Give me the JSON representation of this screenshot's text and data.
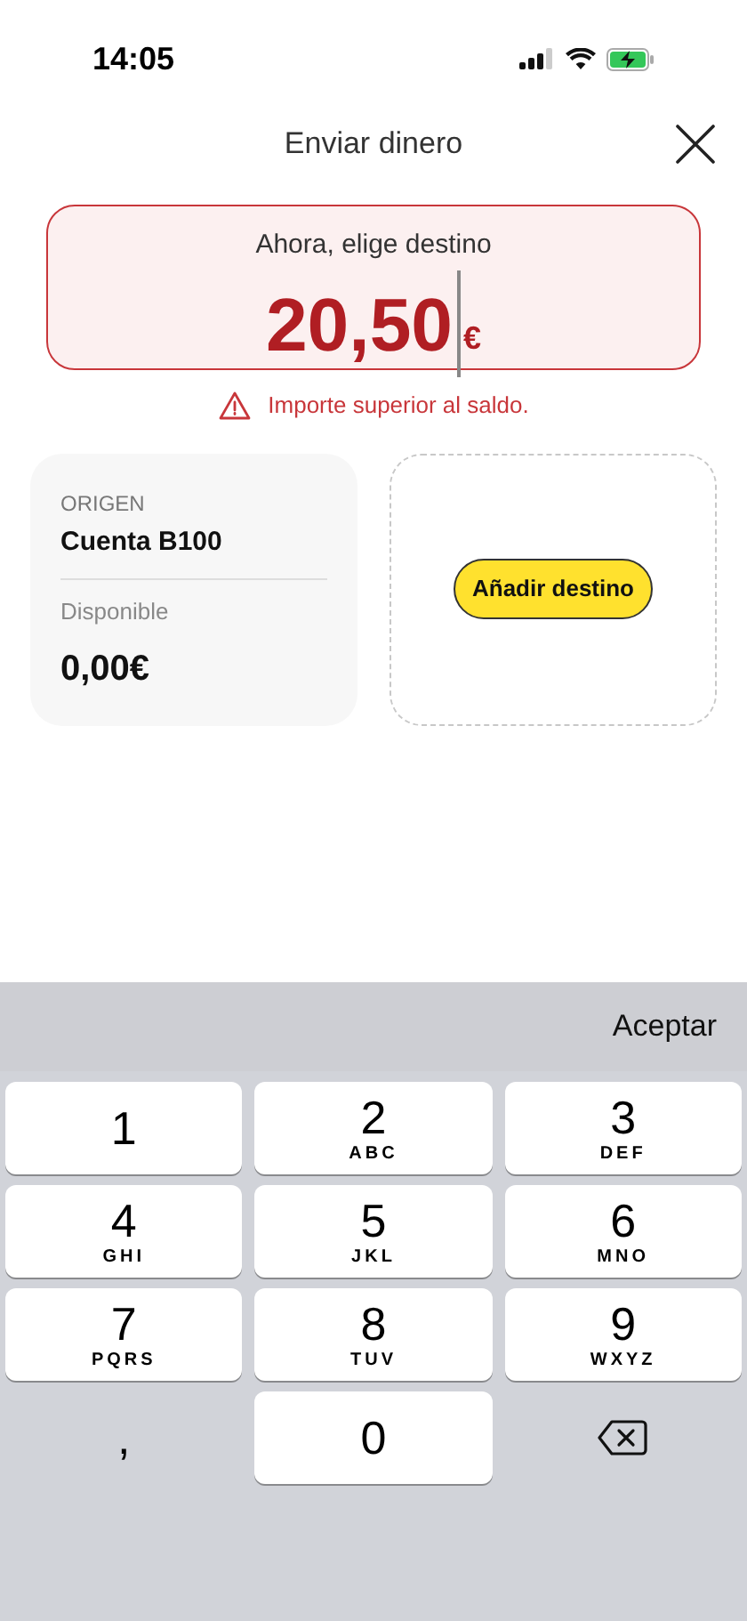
{
  "status_bar": {
    "time": "14:05"
  },
  "header": {
    "title": "Enviar dinero"
  },
  "amount": {
    "prompt": "Ahora, elige destino",
    "value": "20,50",
    "currency": "€",
    "error": true
  },
  "error_message": "Importe superior al saldo.",
  "origin": {
    "label": "ORIGEN",
    "account": "Cuenta B100",
    "balance_label": "Disponible",
    "balance": "0,00€"
  },
  "destination": {
    "button": "Añadir destino"
  },
  "keyboard": {
    "accept": "Aceptar",
    "keys": [
      {
        "kind": "digit",
        "digit": "1"
      },
      {
        "kind": "digit",
        "digit": "2",
        "letters": "ABC"
      },
      {
        "kind": "digit",
        "digit": "3",
        "letters": "DEF"
      },
      {
        "kind": "digit",
        "digit": "4",
        "letters": "GHI"
      },
      {
        "kind": "digit",
        "digit": "5",
        "letters": "JKL"
      },
      {
        "kind": "digit",
        "digit": "6",
        "letters": "MNO"
      },
      {
        "kind": "digit",
        "digit": "7",
        "letters": "PQRS"
      },
      {
        "kind": "digit",
        "digit": "8",
        "letters": "TUV"
      },
      {
        "kind": "digit",
        "digit": "9",
        "letters": "WXYZ"
      },
      {
        "kind": "comma",
        "digit": ","
      },
      {
        "kind": "digit",
        "digit": "0"
      },
      {
        "kind": "backspace"
      }
    ]
  }
}
